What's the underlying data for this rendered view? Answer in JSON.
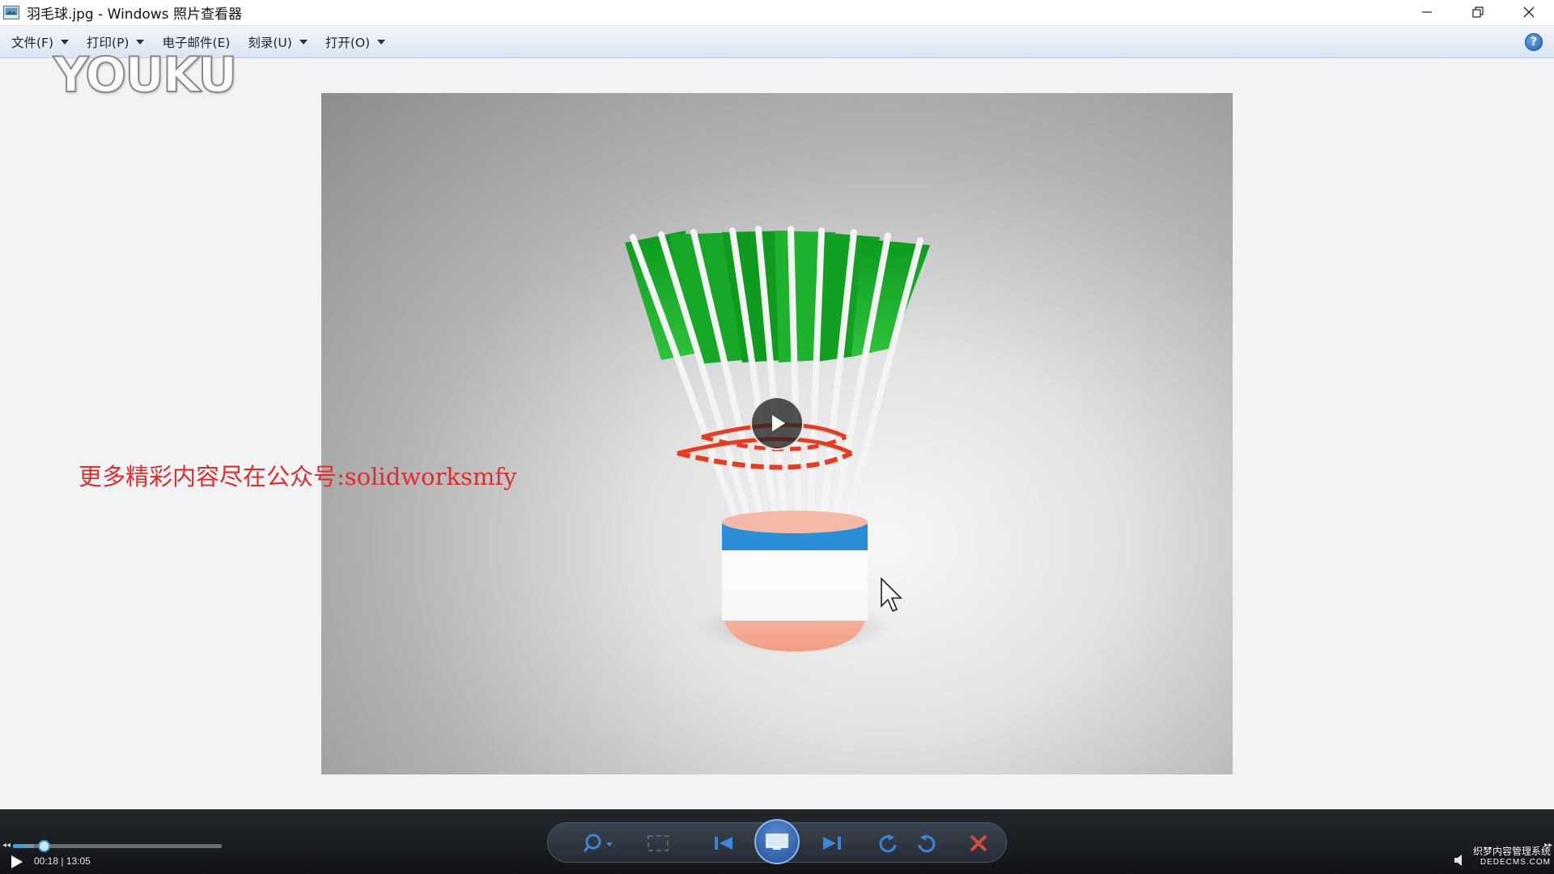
{
  "window": {
    "title": "羽毛球.jpg - Windows 照片查看器",
    "app_icon": "photo-viewer-icon",
    "controls": [
      "minimize-icon",
      "restore-icon",
      "close-icon"
    ]
  },
  "menu": {
    "items": [
      {
        "label": "文件(F)",
        "has_dropdown": true
      },
      {
        "label": "打印(P)",
        "has_dropdown": true
      },
      {
        "label": "电子邮件(E)",
        "has_dropdown": false
      },
      {
        "label": "刻录(U)",
        "has_dropdown": true
      },
      {
        "label": "打开(O)",
        "has_dropdown": true
      }
    ],
    "help_label": "?"
  },
  "watermark": {
    "logo": "YOUKU"
  },
  "photo": {
    "subject": "badminton-shuttlecock-render",
    "overlay_text": "更多精彩内容尽在公众号:solidworksmfy"
  },
  "toolbar": {
    "icons": [
      "zoom-icon",
      "fit-window-icon",
      "previous-icon",
      "slideshow-icon",
      "next-icon",
      "rotate-left-icon",
      "rotate-right-icon",
      "delete-icon"
    ]
  },
  "player": {
    "current_time": "00:18",
    "duration": "13:05",
    "time_display": "00:18 | 13:05",
    "progress": 0.023,
    "buffered": 0.285
  },
  "corner_watermark": {
    "line1": "织梦内容管理系统",
    "line2": "DEDECMS.COM"
  },
  "colors": {
    "accent": "#2aa6e0",
    "overlay_text": "#e22b2b",
    "feathers": "#1fa531"
  }
}
